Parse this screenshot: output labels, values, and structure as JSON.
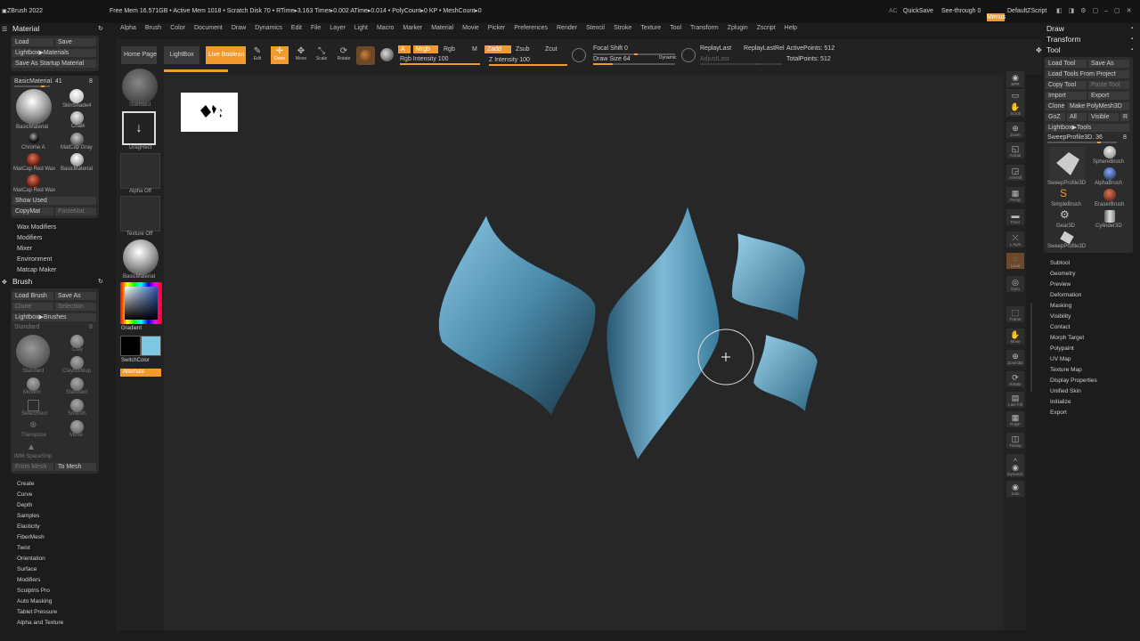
{
  "app": {
    "title": "ZBrush 2022",
    "status": "Free Mem 16.571GB • Active Mem 1018 • Scratch Disk 70 • RTime▸3.163 Timer▸0.002 ATime▸0.014 • PolyCount▸0 KP • MeshCount▸0",
    "ac": "AC",
    "quicksave": "QuickSave",
    "seethrough": "See-through",
    "seethrough_val": "0",
    "menus": "Menus",
    "script": "DefaultZScript"
  },
  "menubar": [
    "Alpha",
    "Brush",
    "Color",
    "Document",
    "Draw",
    "Dynamics",
    "Edit",
    "File",
    "Layer",
    "Light",
    "Macro",
    "Marker",
    "Material",
    "Movie",
    "Picker",
    "Preferences",
    "Render",
    "Stencil",
    "Stroke",
    "Texture",
    "Tool",
    "Transform",
    "Zplugin",
    "Zscript",
    "Help"
  ],
  "shelf": {
    "home": "Home Page",
    "lightbox": "LightBox",
    "liveboolean": "Live Boolean",
    "edit": "Edit",
    "draw": "Draw",
    "move": "Move",
    "scale": "Scale",
    "rotate": "Rotate",
    "a": "A",
    "mrgb": "Mrgb",
    "rgb": "Rgb",
    "m": "M",
    "rgb_intensity": "Rgb Intensity 100",
    "zadd": "Zadd",
    "zsub": "Zsub",
    "zcut": "Zcut",
    "z_intensity": "Z Intensity 100",
    "focal_shift": "Focal Shift 0",
    "draw_size": "Draw Size 64",
    "dynamic": "Dynamic",
    "replaylast": "ReplayLast",
    "replaylastrel": "ReplayLastRel",
    "adjustlast": "AdjustLast",
    "activepoints": "ActivePoints: 512",
    "totalpoints": "TotalPoints: 512"
  },
  "left": {
    "material_title": "Material",
    "load": "Load",
    "save": "Save",
    "lightbox_materials": "Lightbox▶Materials",
    "save_startup": "Save As Startup Material",
    "basicmaterial_slider": "BasicMaterial. 41",
    "basicmaterial_num": "8",
    "materials": [
      "BasicMaterial",
      "SkinShade4",
      "Chrome A",
      "Chalk",
      "MatCap Red Wax",
      "MatCap Gray",
      "MatCap Red Wax",
      "BasicMaterial"
    ],
    "show_used": "Show Used",
    "copymat": "CopyMat",
    "pastemat": "PasteMat",
    "sections": [
      "Wax Modifiers",
      "Modifiers",
      "Mixer",
      "Environment",
      "Matcap Maker"
    ],
    "brush_title": "Brush",
    "load_brush": "Load Brush",
    "save_as": "Save As",
    "clone": "Clone",
    "selection": "Selection",
    "lightbox_brushes": "Lightbox▶Brushes",
    "standard_slider": "Standard",
    "standard_num": "8",
    "brushes": [
      "Standard",
      "Clay",
      "ClayBuildup",
      "MoveIn",
      "Standard",
      "SelectRect",
      "Smooth",
      "Transpose",
      "Move",
      "IMM SpaceShip"
    ],
    "from_mesh": "From Mesh",
    "to_mesh": "To Mesh",
    "brush_sections": [
      "Create",
      "Curve",
      "Depth",
      "Samples",
      "Elasticity",
      "FiberMesh",
      "Twist",
      "Orientation",
      "Surface",
      "Modifiers",
      "Sculptris Pro",
      "Auto Masking",
      "Tablet Pressure",
      "Alpha and Texture"
    ]
  },
  "tray": {
    "standard": "Standard",
    "dragrect": "DragRect",
    "alpha_off": "Alpha Off",
    "texture_off": "Texture Off",
    "basicmaterial": "BasicMaterial",
    "gradient": "Gradient",
    "switchcolor": "SwitchColor",
    "alternate": "Alternate"
  },
  "rightshelf": [
    "BPR",
    "SPix 3",
    "Scroll",
    "Zoom",
    "Actual",
    "AAHalf",
    "Persp",
    "Floor",
    "L.Sym",
    "Local",
    "Gyro",
    "Frame",
    "Move",
    "Zoom3D",
    "Rotate",
    "Line Fill",
    "PolyF",
    "Transp",
    "Ghost",
    "Dynamic",
    "Solo",
    "Xpose"
  ],
  "right": {
    "draw": "Draw",
    "transform": "Transform",
    "tool": "Tool",
    "load_tool": "Load Tool",
    "save_as": "Save As",
    "load_project": "Load Tools From Project",
    "copy_tool": "Copy Tool",
    "paste_tool": "Paste Tool",
    "import": "Import",
    "export": "Export",
    "clone": "Clone",
    "make_polymesh": "Make PolyMesh3D",
    "goz": "GoZ",
    "all": "All",
    "visible": "Visible",
    "r": "R",
    "lightbox_tools": "Lightbox▶Tools",
    "sweep_slider": "SweepProfile3D. 36",
    "sweep_num": "8",
    "tools": [
      "SweepProfile3D",
      "SphereBrush",
      "AlphaBrush",
      "SimpleBrush",
      "EraserBrush",
      "Gear3D",
      "Cylinder3D",
      "SweepProfile3D"
    ],
    "sections": [
      "Subtool",
      "Geometry",
      "Preview",
      "Deformation",
      "Masking",
      "Visibility",
      "Contact",
      "Morph Target",
      "Polypaint",
      "UV Map",
      "Texture Map",
      "Display Properties",
      "Unified Skin",
      "Initialize",
      "Export"
    ]
  },
  "colors": {
    "accent": "#f39a2c",
    "secondary": "#7ec8e3",
    "shape": "#5a98b8"
  }
}
